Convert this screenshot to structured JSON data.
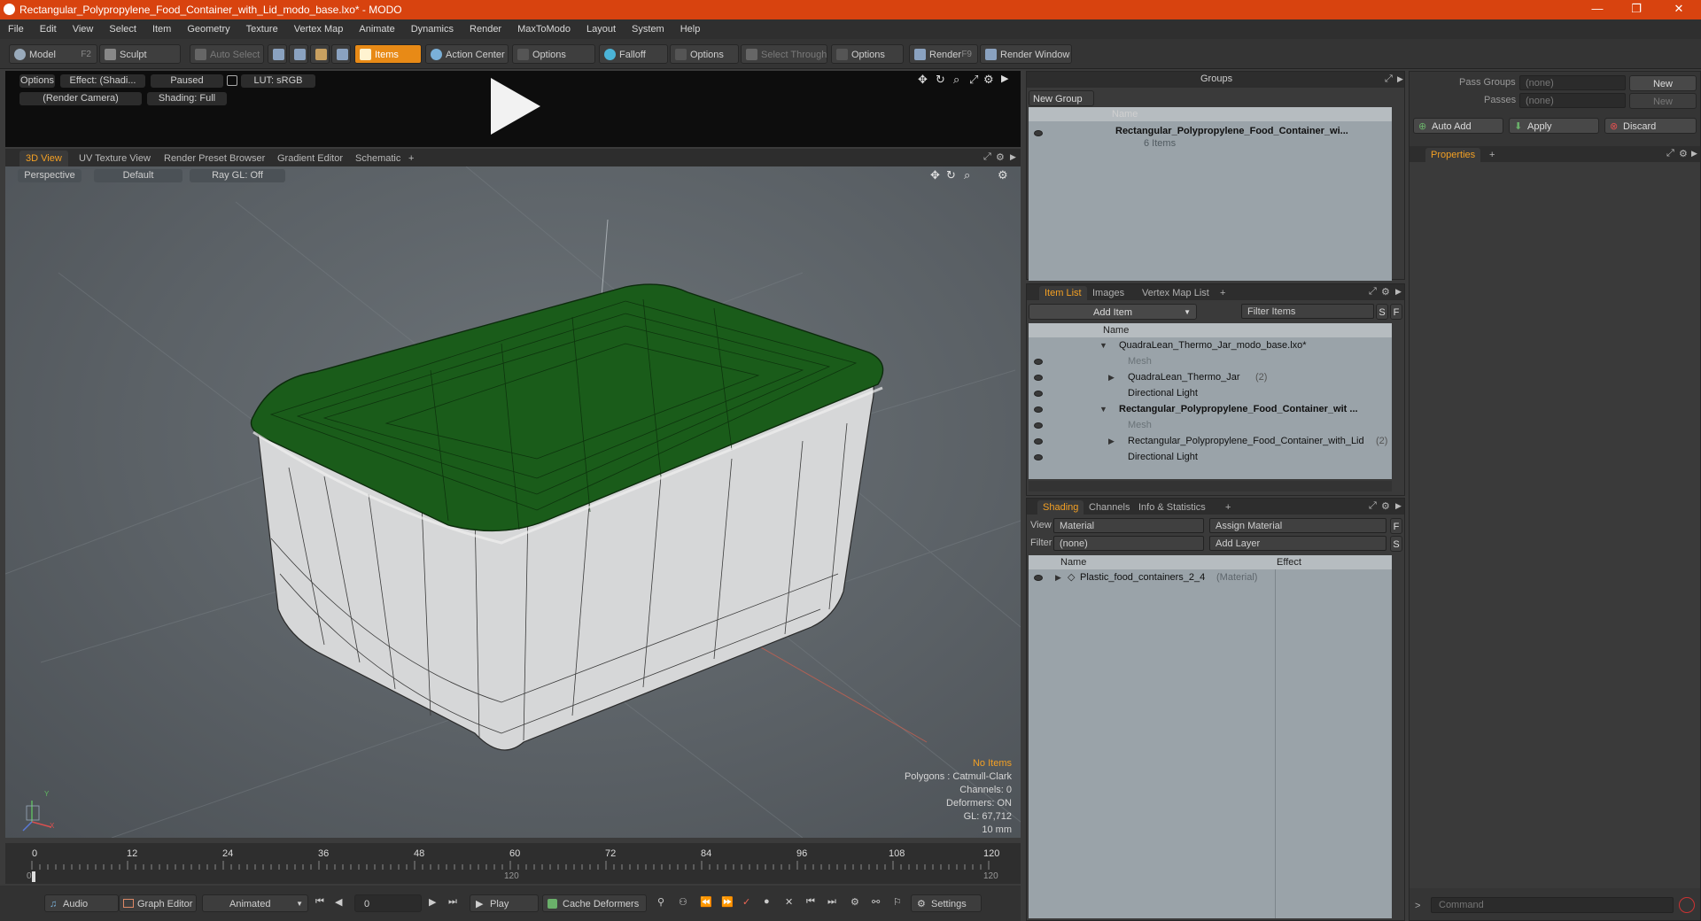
{
  "window": {
    "title": "Rectangular_Polypropylene_Food_Container_with_Lid_modo_base.lxo* - MODO",
    "controls": [
      "—",
      "❐",
      "✕"
    ]
  },
  "menu": [
    "File",
    "Edit",
    "View",
    "Select",
    "Item",
    "Geometry",
    "Texture",
    "Vertex Map",
    "Animate",
    "Dynamics",
    "Render",
    "MaxToModo",
    "Layout",
    "System",
    "Help"
  ],
  "toolbar": {
    "model": "Model",
    "model_key": "F2",
    "sculpt": "Sculpt",
    "auto_select": "Auto Select",
    "items": "Items",
    "action_center": "Action Center",
    "options1": "Options",
    "falloff": "Falloff",
    "options2": "Options",
    "select_through": "Select Through",
    "options3": "Options",
    "render": "Render",
    "render_key": "F9",
    "render_window": "Render Window"
  },
  "render_strip": {
    "options": "Options",
    "effect": "Effect: (Shadi...",
    "paused": "Paused",
    "lut": "LUT: sRGB",
    "camera": "(Render Camera)",
    "shading": "Shading: Full"
  },
  "viewport_tabs": [
    "3D View",
    "UV Texture View",
    "Render Preset Browser",
    "Gradient Editor",
    "Schematic",
    "+"
  ],
  "viewport": {
    "perspective": "Perspective",
    "default": "Default",
    "raygl": "Ray GL: Off",
    "stats": {
      "no_items": "No Items",
      "polygons": "Polygons : Catmull-Clark",
      "channels": "Channels: 0",
      "deformers": "Deformers: ON",
      "gl": "GL: 67,712",
      "scale": "10 mm"
    },
    "axis_x": "X",
    "axis_y": "Y"
  },
  "timeline": {
    "ticks": [
      "0",
      "12",
      "24",
      "36",
      "48",
      "60",
      "72",
      "84",
      "96",
      "108",
      "120"
    ],
    "sub_start": "0",
    "sub_mid": "120",
    "sub_end": "120"
  },
  "transport": {
    "audio": "Audio",
    "graph_editor": "Graph Editor",
    "animated": "Animated",
    "frame": "0",
    "play": "Play",
    "cache_deformers": "Cache Deformers",
    "settings": "Settings"
  },
  "groups": {
    "title": "Groups",
    "new_group": "New Group",
    "col_name": "Name",
    "item_name": "Rectangular_Polypropylene_Food_Container_wi...",
    "item_sub": "6 Items"
  },
  "pass_groups": {
    "pass_groups_label": "Pass Groups",
    "pass_groups_value": "(none)",
    "passes_label": "Passes",
    "passes_value": "(none)",
    "new": "New",
    "new2": "New",
    "auto_add": "Auto Add",
    "apply": "Apply",
    "discard": "Discard",
    "properties_tab": "Properties",
    "command_placeholder": "Command"
  },
  "item_list": {
    "tabs": [
      "Item List",
      "Images",
      "Vertex Map List",
      "+"
    ],
    "add_item": "Add Item",
    "filter_items": "Filter Items",
    "s": "S",
    "f": "F",
    "col_name": "Name",
    "rows": [
      {
        "label": "QuadraLean_Thermo_Jar_modo_base.lxo*",
        "suffix": ""
      },
      {
        "label": "Mesh",
        "suffix": ""
      },
      {
        "label": "QuadraLean_Thermo_Jar",
        "suffix": "(2)"
      },
      {
        "label": "Directional Light",
        "suffix": ""
      },
      {
        "label": "Rectangular_Polypropylene_Food_Container_wit ...",
        "suffix": ""
      },
      {
        "label": "Mesh",
        "suffix": ""
      },
      {
        "label": "Rectangular_Polypropylene_Food_Container_with_Lid",
        "suffix": "(2)"
      },
      {
        "label": "Directional Light",
        "suffix": ""
      }
    ]
  },
  "shading": {
    "tabs": [
      "Shading",
      "Channels",
      "Info & Statistics",
      "+"
    ],
    "view_label": "View",
    "view_value": "Material",
    "assign_material": "Assign Material",
    "filter_label": "Filter",
    "filter_value": "(none)",
    "add_layer": "Add Layer",
    "f": "F",
    "s": "S",
    "col_name": "Name",
    "col_effect": "Effect",
    "material_name": "Plastic_food_containers_2_4",
    "material_type": "(Material)"
  },
  "colors": {
    "accent": "#f3a024",
    "titlebar": "#d8430f",
    "lid": "#1a5c1a"
  }
}
